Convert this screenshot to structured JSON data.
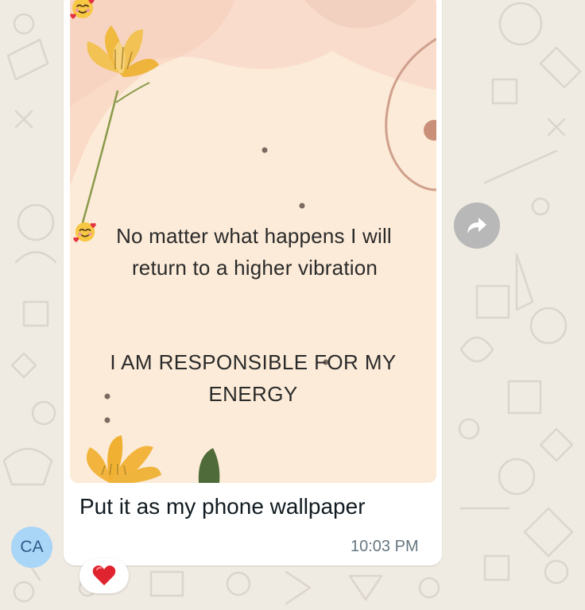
{
  "message": {
    "image_text": {
      "line1": "No matter what happens I will",
      "line2": "return to a higher vibration",
      "line3": "I AM RESPONSIBLE FOR MY",
      "line4": "ENERGY"
    },
    "caption": "Put it as my phone wallpaper",
    "timestamp": "10:03 PM",
    "reaction": "heart-emoji"
  },
  "sender": {
    "initials": "CA"
  },
  "icons": {
    "emoji": "smiling-face-with-hearts",
    "forward": "forward-arrow-icon"
  },
  "colors": {
    "chat_background": "#efeae2",
    "bubble": "#ffffff",
    "image_background": "#fcebd8",
    "avatar": "#a9d5f7",
    "forward_button": "#b8b8b8"
  }
}
